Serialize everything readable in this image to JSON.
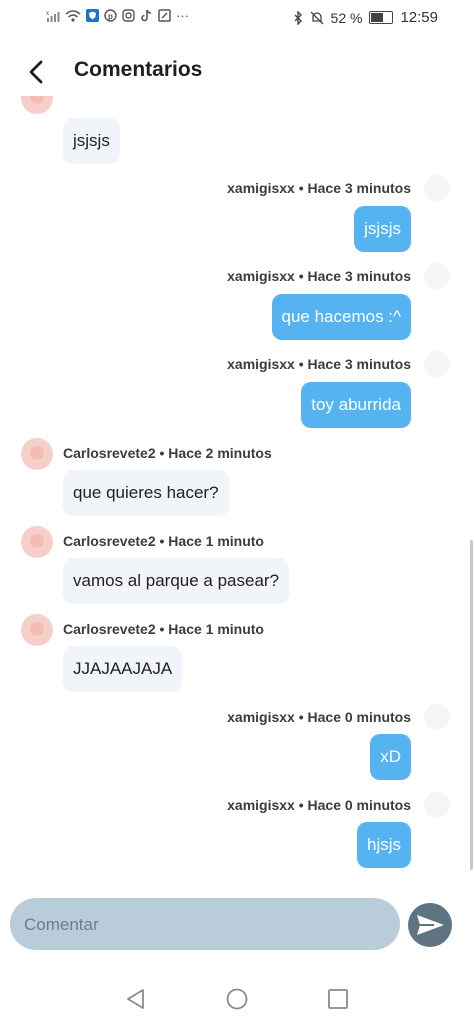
{
  "status_bar": {
    "battery": "52 %",
    "time": "12:59"
  },
  "header": {
    "title": "Comentarios"
  },
  "messages": [
    {
      "side": "in",
      "meta": "",
      "text": "jsjsjs"
    },
    {
      "side": "out",
      "meta": "xamigisxx • Hace 3 minutos",
      "text": "jsjsjs"
    },
    {
      "side": "out",
      "meta": "xamigisxx • Hace 3 minutos",
      "text": "que hacemos :^"
    },
    {
      "side": "out",
      "meta": "xamigisxx • Hace 3 minutos",
      "text": "toy aburrida"
    },
    {
      "side": "in",
      "meta": "Carlosrevete2 • Hace 2 minutos",
      "text": "que quieres hacer?"
    },
    {
      "side": "in",
      "meta": "Carlosrevete2 • Hace 1 minuto",
      "text": "vamos al parque a pasear?"
    },
    {
      "side": "in",
      "meta": "Carlosrevete2 • Hace 1 minuto",
      "text": "JJAJAAJAJA"
    },
    {
      "side": "out",
      "meta": "xamigisxx • Hace 0 minutos",
      "text": "xD"
    },
    {
      "side": "out",
      "meta": "xamigisxx • Hace 0 minutos",
      "text": "hjsjs"
    }
  ],
  "composer": {
    "placeholder": "Comentar"
  },
  "colors": {
    "outgoing_bubble": "#55b3f2",
    "incoming_bubble": "#f1f4f8",
    "composer_bg": "#b8cdd9",
    "send_button": "#5f7482",
    "avatar": "#f6cfc9"
  },
  "icons": {
    "back": "chevron-left-icon",
    "send": "paper-plane-icon",
    "nav": [
      "triangle-back-icon",
      "circle-home-icon",
      "square-recents-icon"
    ]
  }
}
